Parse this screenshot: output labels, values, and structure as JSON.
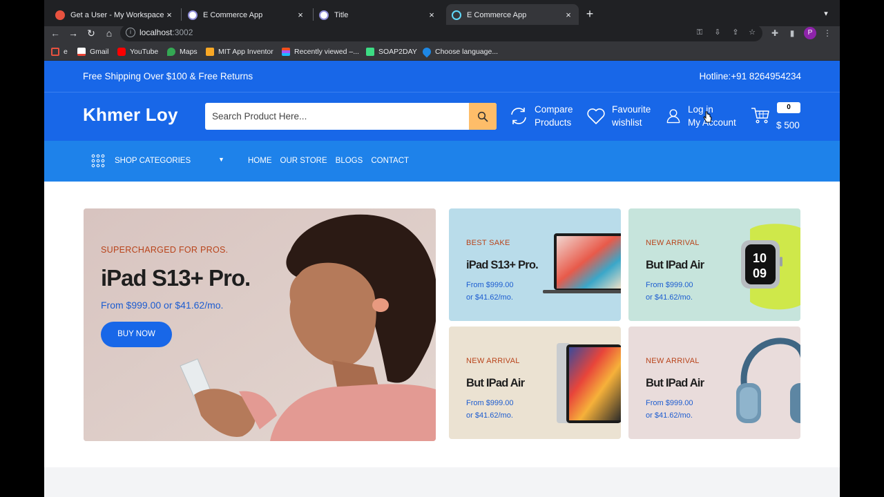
{
  "browser": {
    "tabs": [
      {
        "label": "Get a User - My Workspace",
        "favicon_color": "#e8523f"
      },
      {
        "label": "E Commerce App",
        "favicon_color": "#ffffff"
      },
      {
        "label": "Title",
        "favicon_color": "#ffffff"
      },
      {
        "label": "E Commerce App",
        "favicon_color": "#61dafb"
      }
    ],
    "url_host": "localhost",
    "url_port": ":3002",
    "profile_initial": "P",
    "bookmarks": [
      {
        "label": "e",
        "color": "#e8523f"
      },
      {
        "label": "Gmail",
        "color": "#ea4335"
      },
      {
        "label": "YouTube",
        "color": "#ff0000"
      },
      {
        "label": "Maps",
        "color": "#34a853"
      },
      {
        "label": "MIT App Inventor",
        "color": "#f9a825"
      },
      {
        "label": "Recently viewed –...",
        "color": "#a259ff"
      },
      {
        "label": "SOAP2DAY",
        "color": "#3ddc84"
      },
      {
        "label": "Choose language...",
        "color": "#1e88e5"
      }
    ]
  },
  "site": {
    "topbar": {
      "left_text": "Free Shipping Over $100 & Free Returns",
      "right_text": "Hotline:+91 8264954234"
    },
    "header": {
      "brand": "Khmer Loy",
      "search_placeholder": "Search Product Here...",
      "compare": {
        "line1": "Compare",
        "line2": "Products"
      },
      "favourite": {
        "line1": "Favourite",
        "line2": "wishlist"
      },
      "account": {
        "line1": "Log in",
        "line2": "My Account"
      },
      "cart": {
        "count": "0",
        "total": "$ 500"
      }
    },
    "nav": {
      "categories_label": "SHOP CATEGORIES",
      "menu": [
        "HOME",
        "OUR STORE",
        "BLOGS",
        "CONTACT"
      ]
    },
    "hero": {
      "eyebrow": "SUPERCHARGED FOR PROS.",
      "title": "iPad S13+ Pro.",
      "price": "From $999.00 or $41.62/mo.",
      "button": "BUY NOW"
    },
    "cards": [
      {
        "eyebrow": "BEST SAKE",
        "title": "iPad S13+ Pro.",
        "price1": "From $999.00",
        "price2": "or $41.62/mo.",
        "bg": "#b9dcea",
        "image": "laptop"
      },
      {
        "eyebrow": "NEW ARRIVAL",
        "title": "But IPad Air",
        "price1": "From $999.00",
        "price2": "or $41.62/mo.",
        "bg": "#c6e4dc",
        "image": "smartwatch"
      },
      {
        "eyebrow": "NEW ARRIVAL",
        "title": "But IPad Air",
        "price1": "From $999.00",
        "price2": "or $41.62/mo.",
        "bg": "#ebe2d2",
        "image": "tablet"
      },
      {
        "eyebrow": "NEW ARRIVAL",
        "title": "But IPad Air",
        "price1": "From $999.00",
        "price2": "or $41.62/mo.",
        "bg": "#e9dcdb",
        "image": "headphones"
      }
    ]
  }
}
